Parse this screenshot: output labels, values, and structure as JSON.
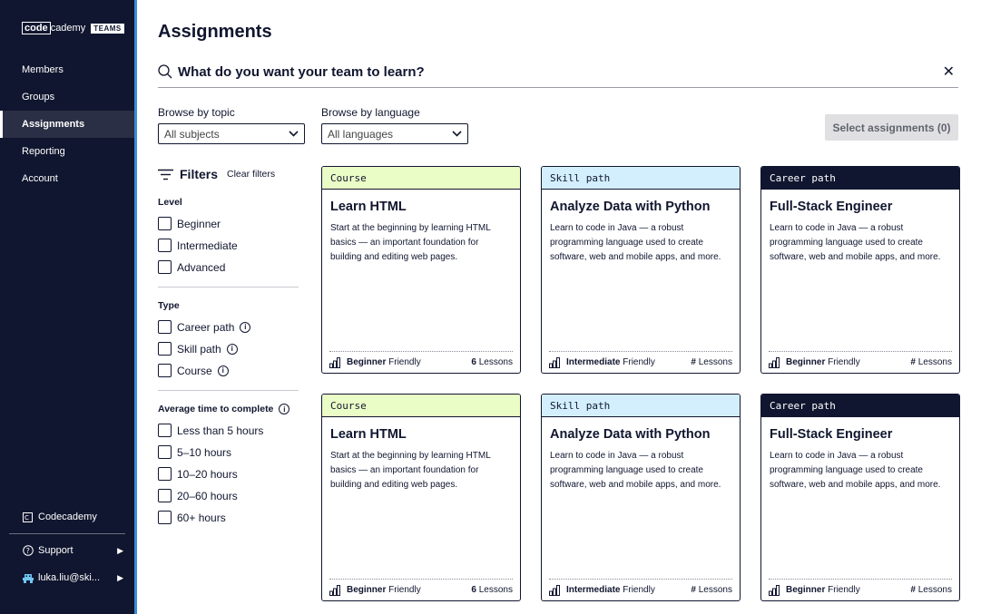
{
  "brand": {
    "code": "code",
    "rest": "cademy",
    "badge": "TEAMS"
  },
  "nav": [
    {
      "label": "Members"
    },
    {
      "label": "Groups"
    },
    {
      "label": "Assignments"
    },
    {
      "label": "Reporting"
    },
    {
      "label": "Account"
    }
  ],
  "sidebar_bottom": {
    "codecademy": "Codecademy",
    "support": "Support",
    "user": "luka.liu@ski..."
  },
  "page": {
    "title": "Assignments"
  },
  "search": {
    "placeholder": "What do you want your team to learn?"
  },
  "browse": {
    "topic_label": "Browse by topic",
    "topic_value": "All subjects",
    "language_label": "Browse by language",
    "language_value": "All languages",
    "select_button": "Select assignments (0)"
  },
  "filters": {
    "title": "Filters",
    "clear": "Clear filters",
    "level": {
      "title": "Level",
      "options": [
        "Beginner",
        "Intermediate",
        "Advanced"
      ]
    },
    "type": {
      "title": "Type",
      "options": [
        "Career path",
        "Skill path",
        "Course"
      ]
    },
    "time": {
      "title": "Average time to complete",
      "options": [
        "Less than 5 hours",
        "5–10 hours",
        "10–20 hours",
        "20–60 hours",
        "60+ hours"
      ]
    }
  },
  "cards": [
    {
      "kind": "Course",
      "title": "Learn HTML",
      "desc": "Start at the beginning by learning HTML basics — an important foundation for building and editing web pages.",
      "level": "Beginner",
      "friendly": "Friendly",
      "lessons_num": "6",
      "lessons": "Lessons"
    },
    {
      "kind": "Skill path",
      "title": "Analyze Data with Python",
      "desc": "Learn to code in Java — a robust programming language used to create software, web and mobile apps, and more.",
      "level": "Intermediate",
      "friendly": "Friendly",
      "lessons_num": "#",
      "lessons": "Lessons"
    },
    {
      "kind": "Career path",
      "title": "Full-Stack Engineer",
      "desc": "Learn to code in Java — a robust programming language used to create software, web and mobile apps, and more.",
      "level": "Beginner",
      "friendly": "Friendly",
      "lessons_num": "#",
      "lessons": "Lessons"
    },
    {
      "kind": "Course",
      "title": "Learn HTML",
      "desc": "Start at the beginning by learning HTML basics — an important foundation for building and editing web pages.",
      "level": "Beginner",
      "friendly": "Friendly",
      "lessons_num": "6",
      "lessons": "Lessons"
    },
    {
      "kind": "Skill path",
      "title": "Analyze Data with Python",
      "desc": "Learn to code in Java — a robust programming language used to create software, web and mobile apps, and more.",
      "level": "Intermediate",
      "friendly": "Friendly",
      "lessons_num": "#",
      "lessons": "Lessons"
    },
    {
      "kind": "Career path",
      "title": "Full-Stack Engineer",
      "desc": "Learn to code in Java — a robust programming language used to create software, web and mobile apps, and more.",
      "level": "Beginner",
      "friendly": "Friendly",
      "lessons_num": "#",
      "lessons": "Lessons"
    }
  ],
  "colors": {
    "navy": "#10162f",
    "course_head": "#eafdc6",
    "skill_head": "#d3effe",
    "accent_edge": "#3a8bd8"
  }
}
